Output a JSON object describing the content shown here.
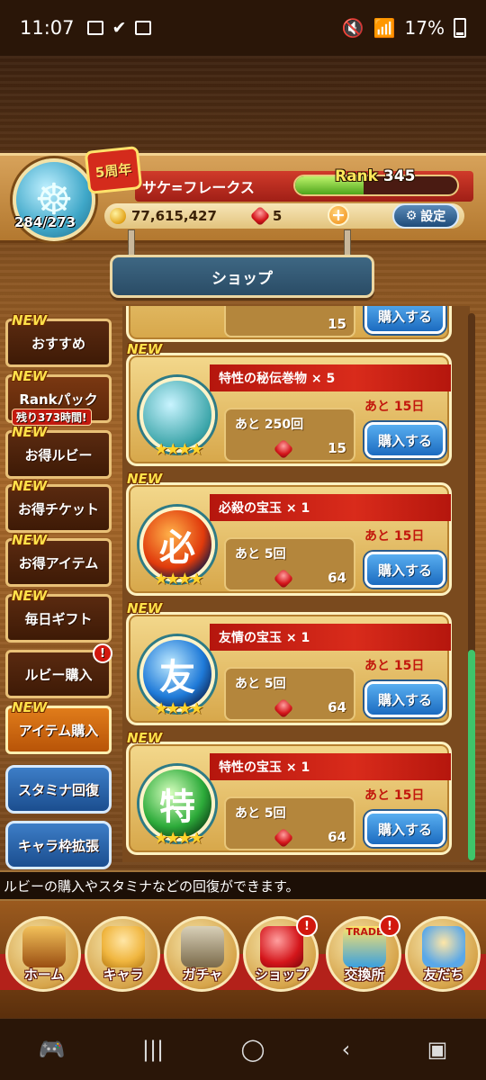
{
  "status_bar": {
    "time": "11:07",
    "battery": "17%"
  },
  "profile": {
    "stamina": "284/273",
    "anniversary_badge": "5周年",
    "player_name": "サケ=フレークス",
    "rank_label": "Rank",
    "rank_value": "345",
    "rank_progress_fraction": 0.42,
    "gold": "77,615,427",
    "ruby_count": "5",
    "settings_label": "設定"
  },
  "shop_title": "ショップ",
  "menu": [
    {
      "label": "おすすめ",
      "new": "NEW"
    },
    {
      "label": "Rankパック",
      "new": "NEW",
      "timer": "残り373時間!"
    },
    {
      "label": "お得ルビー",
      "new": "NEW"
    },
    {
      "label": "お得チケット",
      "new": "NEW"
    },
    {
      "label": "お得アイテム",
      "new": "NEW"
    },
    {
      "label": "毎日ギフト",
      "new": "NEW"
    },
    {
      "label": "ルビー購入",
      "alert": "!"
    },
    {
      "label": "アイテム購入",
      "new": "NEW"
    },
    {
      "label": "スタミナ回復"
    },
    {
      "label": "キャラ枠拡張"
    }
  ],
  "partial_card": {
    "price": "15",
    "buy_label": "購入する"
  },
  "items": [
    {
      "new": "NEW",
      "title": "特性の秘伝巻物 × 5",
      "stock": "あと 250回",
      "price": "15",
      "days": "あと 15日",
      "buy_label": "購入する",
      "icon": "scroll-character-icon",
      "icon_glyph": ""
    },
    {
      "new": "NEW",
      "title": "必殺の宝玉 × 1",
      "stock": "あと 5回",
      "price": "64",
      "days": "あと 15日",
      "buy_label": "購入する",
      "icon": "special-orb-icon",
      "icon_glyph": "必"
    },
    {
      "new": "NEW",
      "title": "友情の宝玉 × 1",
      "stock": "あと 5回",
      "price": "64",
      "days": "あと 15日",
      "buy_label": "購入する",
      "icon": "friendship-orb-icon",
      "icon_glyph": "友"
    },
    {
      "new": "NEW",
      "title": "特性の宝玉 × 1",
      "stock": "あと 5回",
      "price": "64",
      "days": "あと 15日",
      "buy_label": "購入する",
      "icon": "trait-orb-icon",
      "icon_glyph": "特"
    }
  ],
  "info_text": "ルビーの購入やスタミナなどの回復ができます。",
  "bottom_nav": [
    {
      "label": "ホーム",
      "icon": "ship-icon"
    },
    {
      "label": "キャラ",
      "icon": "character-icon"
    },
    {
      "label": "ガチャ",
      "icon": "gacha-icon"
    },
    {
      "label": "ショップ",
      "icon": "ruby-icon",
      "alert": "!"
    },
    {
      "label": "交換所",
      "icon": "trade-icon",
      "alert": "!",
      "badge": "TRADE"
    },
    {
      "label": "友だち",
      "icon": "friends-icon"
    }
  ],
  "colors": {
    "accent_red": "#b3211a",
    "buy_blue": "#1c6bc0",
    "wood": "#a8692a"
  }
}
